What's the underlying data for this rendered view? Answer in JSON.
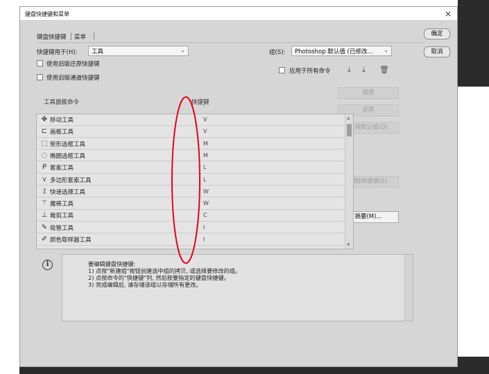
{
  "window": {
    "title": "键盘快捷键和菜单",
    "close_glyph": "×"
  },
  "tabs": [
    {
      "label": "键盘快捷键",
      "active": true
    },
    {
      "label": "菜单",
      "active": false
    }
  ],
  "shortcuts_for": {
    "label": "快捷键用于(H):",
    "value": "工具"
  },
  "set": {
    "label": "组(S):",
    "value": "Photoshop 默认值 (已修改..."
  },
  "checkboxes": {
    "legacy_undo": "使用旧版还原快捷键",
    "legacy_channel": "使用旧版通道快捷键",
    "apply_all": "应用于所有命令"
  },
  "columns": {
    "command": "工具面板命令",
    "shortcut": "快捷键"
  },
  "tools": [
    {
      "name": "移动工具",
      "key": "V",
      "icon": "move-icon",
      "glyph": "✥"
    },
    {
      "name": "画板工具",
      "key": "V",
      "icon": "artboard-icon",
      "glyph": "⊏"
    },
    {
      "name": "矩形选框工具",
      "key": "M",
      "icon": "rect-marquee-icon",
      "glyph": "⬚"
    },
    {
      "name": "椭圆选框工具",
      "key": "M",
      "icon": "ellipse-marquee-icon",
      "glyph": "◌"
    },
    {
      "name": "套索工具",
      "key": "L",
      "icon": "lasso-icon",
      "glyph": "ᑭ"
    },
    {
      "name": "多边形套索工具",
      "key": "L",
      "icon": "polygon-lasso-icon",
      "glyph": "⋎"
    },
    {
      "name": "快速选择工具",
      "key": "W",
      "icon": "quick-select-icon",
      "glyph": "⁒"
    },
    {
      "name": "魔棒工具",
      "key": "W",
      "icon": "magic-wand-icon",
      "glyph": "⚚"
    },
    {
      "name": "裁剪工具",
      "key": "C",
      "icon": "crop-icon",
      "glyph": "⊥"
    },
    {
      "name": "吸管工具",
      "key": "I",
      "icon": "eyedropper-icon",
      "glyph": "✎"
    },
    {
      "name": "颜色取样器工具",
      "key": "I",
      "icon": "color-sampler-icon",
      "glyph": "✐"
    }
  ],
  "buttons": {
    "ok": "确定",
    "cancel": "取消",
    "accept": "接受",
    "undo": "还原",
    "use_default": "使用默认值(D)",
    "delete_shortcut": "删除快捷键(E)",
    "summarize": "摘要(M)..."
  },
  "info": {
    "lines": [
      "要编辑键盘快捷键:",
      "1) 点按\"新建组\"按钮创建选中组的拷贝, 或选择要修改的组。",
      "2) 点按命令的\"快捷键\"列, 然后按要指定的键盘快捷键。",
      "3) 完成编辑后, 请存储该组以存储所有更改。"
    ]
  },
  "colors": {
    "annotation": "#e8001c",
    "dialog_bg": "#d6d6d6"
  }
}
